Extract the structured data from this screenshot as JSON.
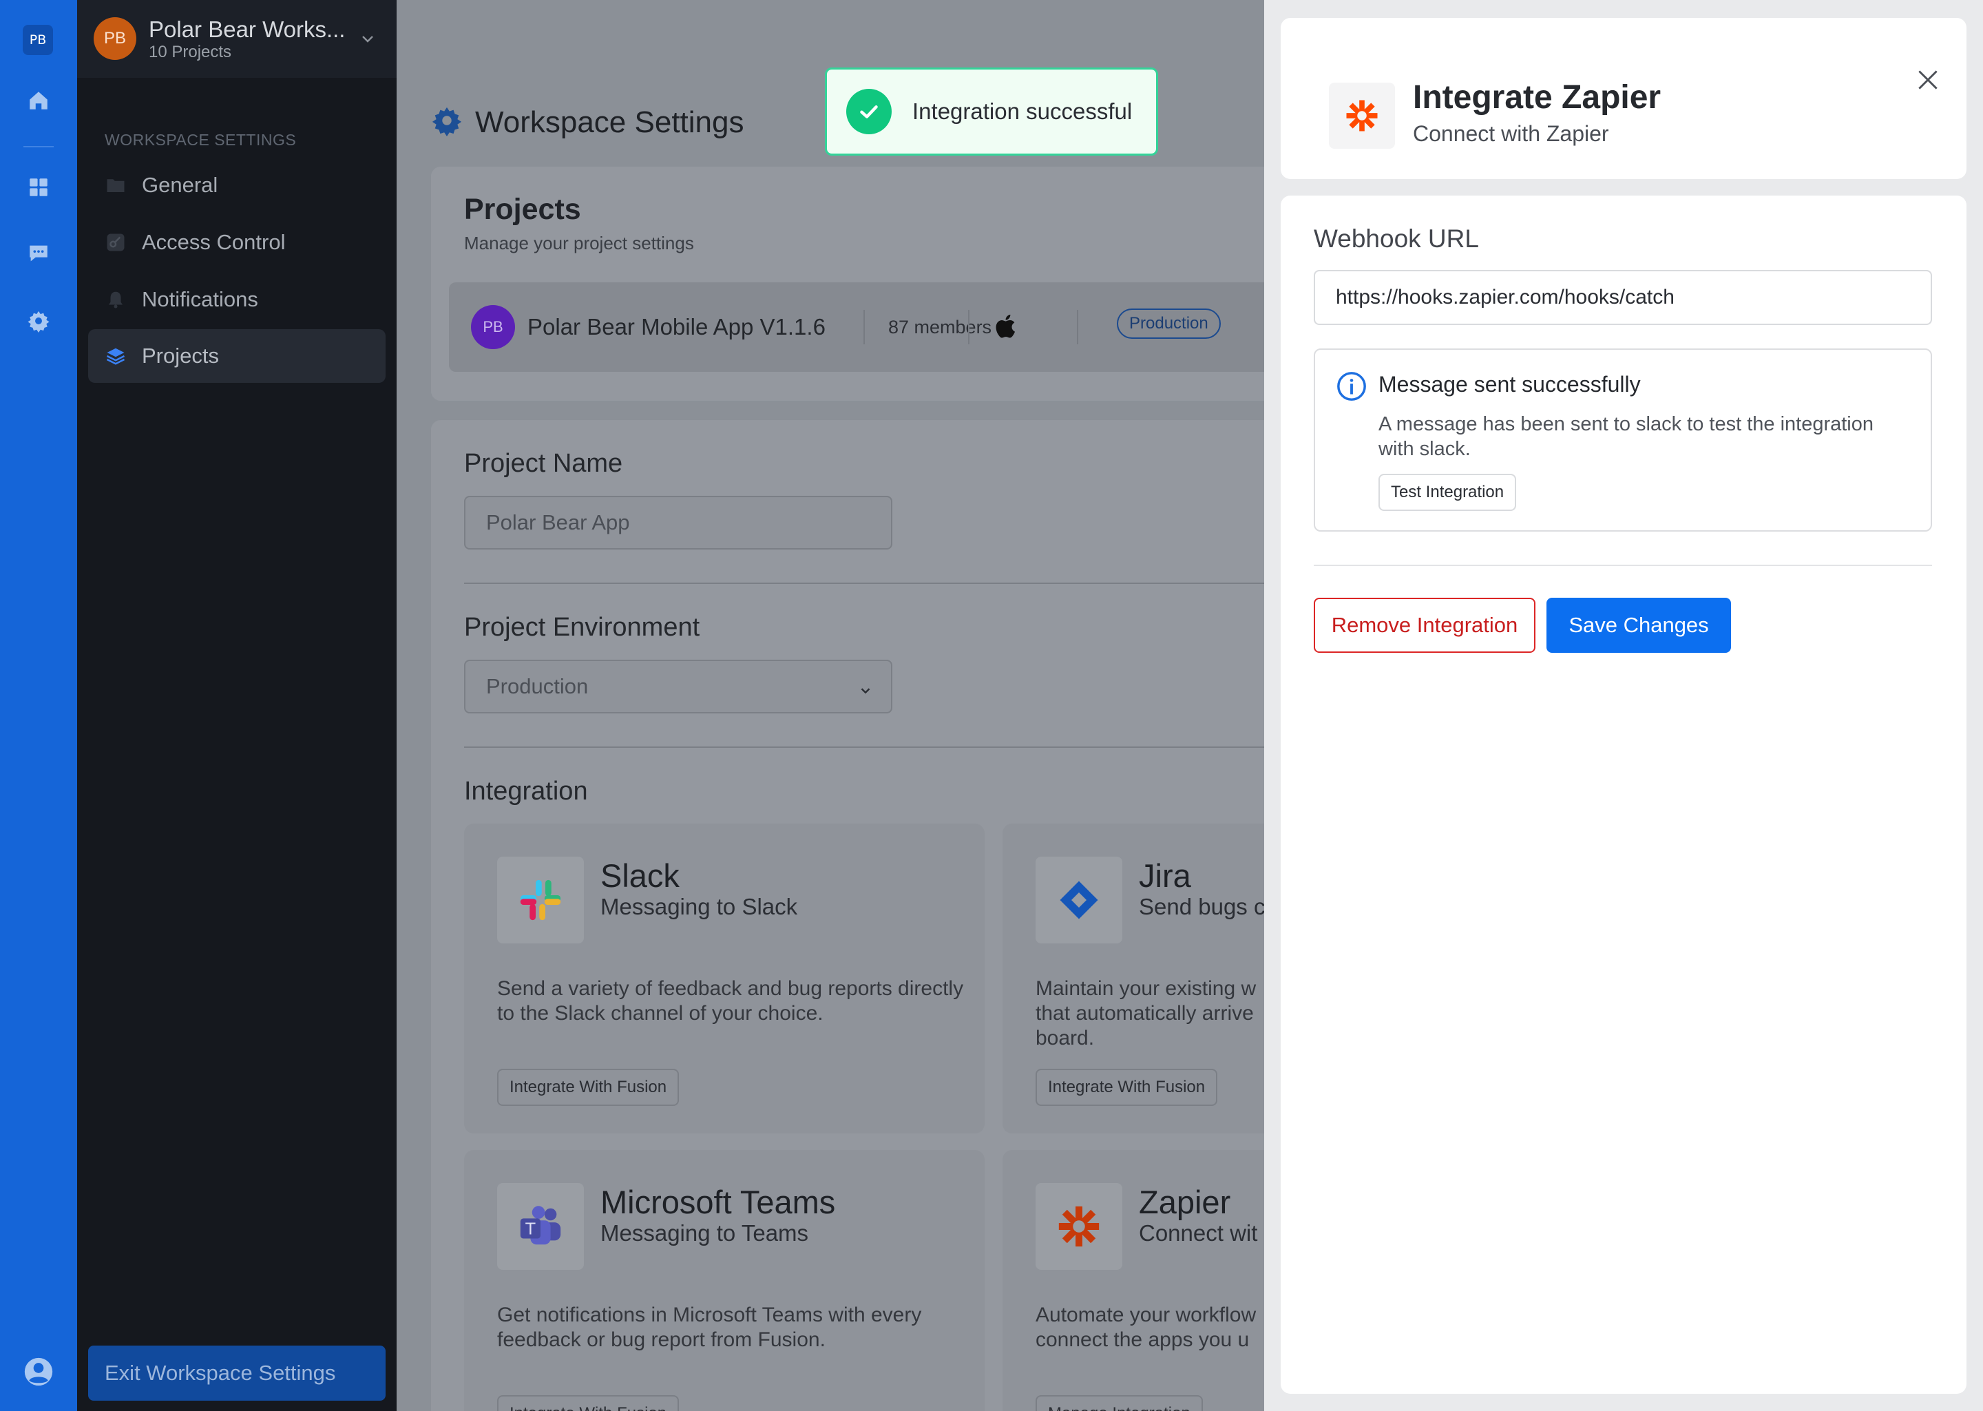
{
  "rail": {
    "logo": "PB",
    "icons": [
      "home-icon",
      "grid-icon",
      "chat-icon",
      "gear-icon",
      "user-circle-icon"
    ]
  },
  "workspace": {
    "avatar": "PB",
    "name": "Polar Bear Works...",
    "subtitle": "10 Projects"
  },
  "sidebar": {
    "section_label": "WORKSPACE SETTINGS",
    "items": [
      {
        "label": "General",
        "icon": "folder-icon"
      },
      {
        "label": "Access Control",
        "icon": "key-icon"
      },
      {
        "label": "Notifications",
        "icon": "bell-icon"
      },
      {
        "label": "Projects",
        "icon": "layers-icon",
        "active": true
      }
    ],
    "exit_label": "Exit Workspace Settings"
  },
  "main": {
    "title": "Workspace Settings",
    "projects": {
      "heading": "Projects",
      "subheading": "Manage your project settings",
      "row": {
        "avatar": "PB",
        "name": "Polar Bear Mobile App V1.1.6",
        "members": "87 members",
        "platform_icon": "apple-icon",
        "badge": "Production"
      }
    },
    "form": {
      "project_name_label": "Project Name",
      "project_name_value": "Polar Bear App",
      "environment_label": "Project Environment",
      "environment_value": "Production",
      "integration_label": "Integration"
    },
    "integrations": [
      {
        "name": "Slack",
        "subtitle": "Messaging to Slack",
        "description": "Send a variety of feedback and bug reports directly to the Slack channel of your choice.",
        "button": "Integrate With Fusion",
        "icon": "slack-icon"
      },
      {
        "name": "Jira",
        "subtitle": "Send bugs c",
        "description": "Maintain your existing w that automatically arrive board.",
        "button": "Integrate With Fusion",
        "icon": "jira-icon"
      },
      {
        "name": "Microsoft Teams",
        "subtitle": "Messaging to Teams",
        "description": "Get notifications in Microsoft Teams with every feedback or bug report from Fusion.",
        "button": "Integrate With Fusion",
        "icon": "teams-icon"
      },
      {
        "name": "Zapier",
        "subtitle": "Connect wit",
        "description": "Automate your workflow connect the apps you u",
        "button": "Manage Integration",
        "icon": "zapier-icon"
      }
    ]
  },
  "toast": {
    "text": "Integration successful",
    "icon": "check-icon"
  },
  "drawer": {
    "title": "Integrate Zapier",
    "subtitle": "Connect with Zapier",
    "webhook_label": "Webhook URL",
    "webhook_value": "https://hooks.zapier.com/hooks/catch",
    "alert": {
      "title": "Message sent successfully",
      "description": "A message has been sent to slack to test the integration with slack.",
      "button": "Test Integration"
    },
    "remove_label": "Remove Integration",
    "save_label": "Save Changes"
  },
  "colors": {
    "rail": "#1565d8",
    "sidebar": "#15181e",
    "primary": "#0c6ff0",
    "danger": "#dc2626",
    "success": "#10c77f",
    "zapier": "#ff4a00"
  }
}
